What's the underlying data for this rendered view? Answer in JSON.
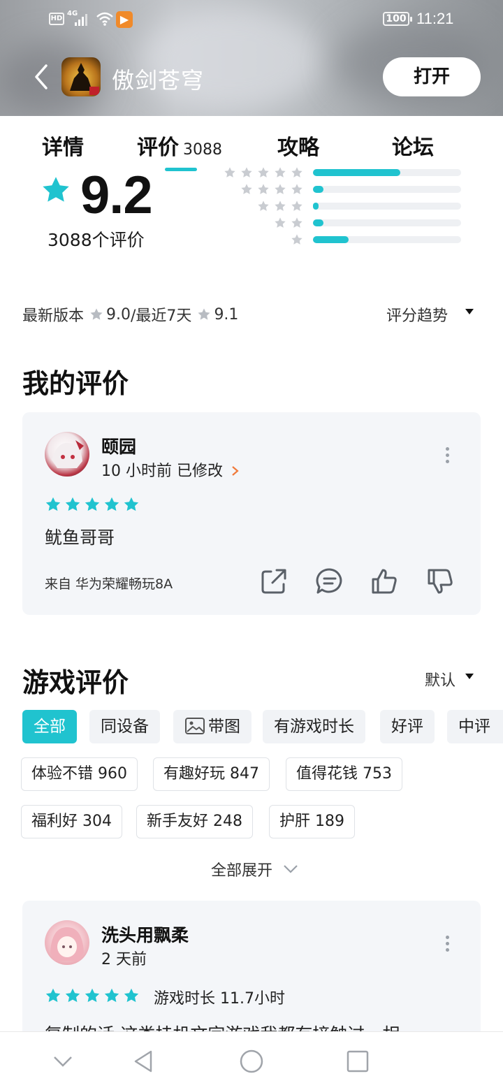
{
  "status_bar": {
    "hd": "HD",
    "network": "4G",
    "battery": "100",
    "time": "11:21"
  },
  "app": {
    "title": "傲剑苍穹",
    "open_label": "打开"
  },
  "tabs": [
    {
      "label": "详情"
    },
    {
      "label": "评价",
      "count": "3088"
    },
    {
      "label": "攻略"
    },
    {
      "label": "论坛"
    }
  ],
  "summary": {
    "score": "9.2",
    "rating_count": "3088个评价",
    "distribution": [
      {
        "stars": 5,
        "fraction": 0.59
      },
      {
        "stars": 4,
        "fraction": 0.07
      },
      {
        "stars": 3,
        "fraction": 0.04
      },
      {
        "stars": 2,
        "fraction": 0.07
      },
      {
        "stars": 1,
        "fraction": 0.24
      }
    ],
    "version_label": "最新版本",
    "version_score": "9.0",
    "recent_label": "/最近7天",
    "recent_score": "9.1",
    "trend_label": "评分趋势"
  },
  "my_review": {
    "section_title": "我的评价",
    "user": "颐园",
    "time": "10 小时前 已修改",
    "stars": 5,
    "text": "鱿鱼哥哥",
    "device": "来自 华为荣耀畅玩8A"
  },
  "game_reviews": {
    "section_title": "游戏评价",
    "sort_label": "默认",
    "filters": [
      "全部",
      "同设备",
      "带图",
      "有游戏时长",
      "好评",
      "中评"
    ],
    "tags": [
      "体验不错 960",
      "有趣好玩 847",
      "值得花钱 753",
      "福利好 304",
      "新手友好 248",
      "护肝 189"
    ],
    "expand_label": "全部展开",
    "first_review": {
      "user": "洗头用飘柔",
      "time": "2 天前",
      "stars": 5,
      "playtime": "游戏时长 11.7小时",
      "text": "复制的话:这类挂机文字游戏我都有接触过，相"
    }
  },
  "colors": {
    "accent": "#20c3cf",
    "card_bg": "#f4f6f9",
    "chip_bg": "#f1f3f6"
  }
}
